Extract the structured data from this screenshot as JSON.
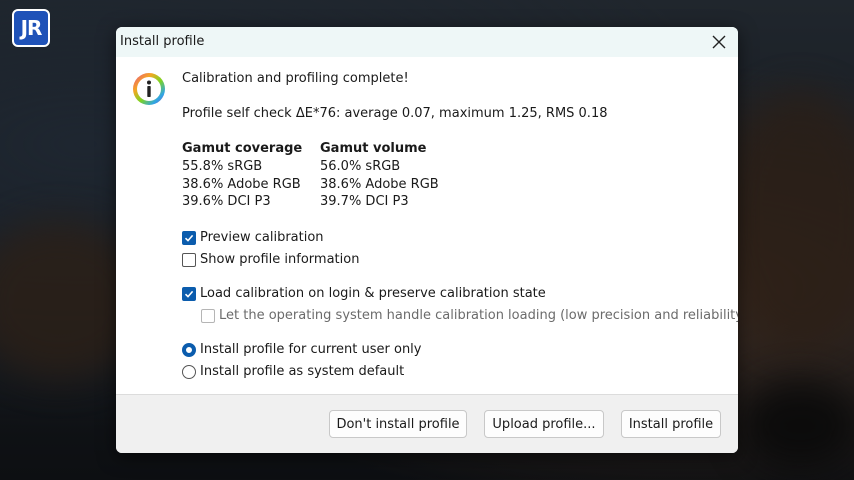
{
  "brand": {
    "logo_text": "JR"
  },
  "dialog": {
    "title": "Install profile",
    "heading": "Calibration and profiling complete!",
    "self_check": "Profile self check ΔE*76: average 0.07, maximum 1.25, RMS 0.18",
    "gamut_coverage": {
      "header": "Gamut coverage",
      "rows": [
        "55.8% sRGB",
        "38.6% Adobe RGB",
        "39.6% DCI P3"
      ]
    },
    "gamut_volume": {
      "header": "Gamut volume",
      "rows": [
        "56.0% sRGB",
        "38.6% Adobe RGB",
        "39.7% DCI P3"
      ]
    },
    "options": {
      "preview_calibration": {
        "label": "Preview calibration",
        "checked": true
      },
      "show_profile_information": {
        "label": "Show profile information",
        "checked": false
      },
      "load_calibration": {
        "label": "Load calibration on login & preserve calibration state",
        "checked": true
      },
      "os_handle_loading": {
        "label": "Let the operating system handle calibration loading (low precision and reliability)",
        "checked": false,
        "disabled": true
      }
    },
    "install_scope": {
      "current_user": {
        "label": "Install profile for current user only",
        "selected": true
      },
      "system_default": {
        "label": "Install profile as system default",
        "selected": false
      }
    },
    "buttons": {
      "dont_install": "Don't install profile",
      "upload": "Upload profile...",
      "install": "Install profile"
    }
  },
  "colors": {
    "accent": "#0b5cad",
    "titlebar": "#eef7f7",
    "logo": "#1f52b8"
  }
}
